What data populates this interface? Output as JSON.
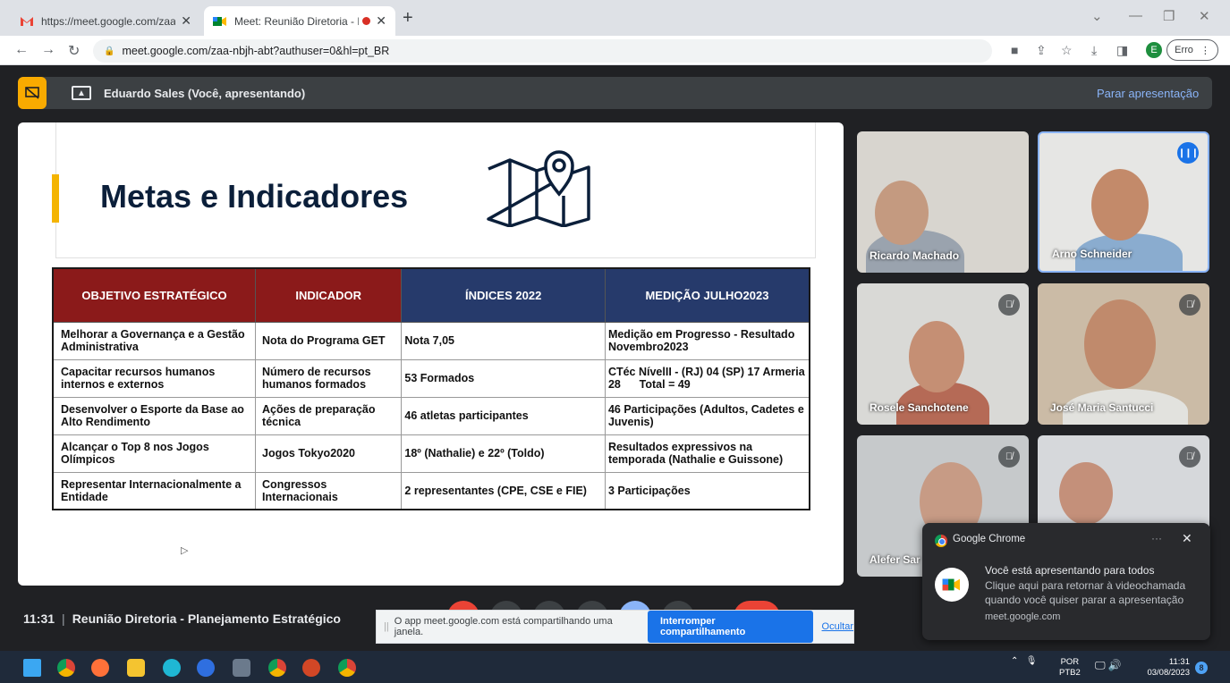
{
  "browser": {
    "tabs": [
      {
        "title": "https://meet.google.com/zaa-nbj",
        "icon": "gmail-icon"
      },
      {
        "title": "Meet: Reunião Diretoria - Pla",
        "icon": "meet-icon",
        "recording": true
      }
    ],
    "url": "meet.google.com/zaa-nbjh-abt?authuser=0&hl=pt_BR",
    "profile_initial": "E",
    "error_label": "Erro"
  },
  "meet": {
    "presenter_label": "Eduardo Sales (Você, apresentando)",
    "stop_presenting": "Parar apresentação",
    "meeting_time": "11:31",
    "meeting_title": "Reunião Diretoria - Planejamento Estratégico"
  },
  "slide": {
    "title": "Metas e Indicadores",
    "headers": [
      "OBJETIVO ESTRATÉGICO",
      "INDICADOR",
      "ÍNDICES 2022",
      "MEDIÇÃO JULHO2023"
    ],
    "rows": [
      [
        "Melhorar a Governança e a Gestão Administrativa",
        "Nota do Programa GET",
        "Nota 7,05",
        "Medição em Progresso - Resultado Novembro2023"
      ],
      [
        "Capacitar recursos humanos internos e externos",
        "Número de recursos humanos formados",
        "53 Formados",
        "CTéc NívelII - (RJ) 04 (SP) 17 Armeria 28      Total = 49"
      ],
      [
        "Desenvolver o Esporte da Base ao Alto Rendimento",
        "Ações de preparação técnica",
        "46 atletas participantes",
        "46 Participações (Adultos, Cadetes e Juvenis)"
      ],
      [
        "Alcançar o Top 8 nos Jogos Olímpicos",
        "Jogos Tokyo2020",
        "18º (Nathalie) e 22º (Toldo)",
        "Resultados expressivos na temporada (Nathalie e Guissone)"
      ],
      [
        "Representar Internacionalmente a Entidade",
        "Congressos Internacionais",
        "2 representantes (CPE, CSE e FIE)",
        "3 Participações"
      ]
    ]
  },
  "participants": [
    {
      "name": "Ricardo Machado",
      "muted": false
    },
    {
      "name": "Arno Schneider",
      "muted": false,
      "speaking": true
    },
    {
      "name": "Rosele Sanchotene",
      "muted": true
    },
    {
      "name": "José Maria Santucci",
      "muted": true
    },
    {
      "name": "Alefer Sar",
      "muted": true
    },
    {
      "name": "",
      "muted": true
    }
  ],
  "sharebar": {
    "message": "O app meet.google.com está compartilhando uma janela.",
    "stop": "Interromper compartilhamento",
    "hide": "Ocultar"
  },
  "notification": {
    "app": "Google Chrome",
    "title": "Você está apresentando para todos",
    "body": "Clique aqui para retornar à videochamada quando você quiser parar a apresentação",
    "source": "meet.google.com"
  },
  "taskbar": {
    "lang_line1": "POR",
    "lang_line2": "PTB2",
    "time": "11:31",
    "date": "03/08/2023",
    "notification_count": "8"
  }
}
